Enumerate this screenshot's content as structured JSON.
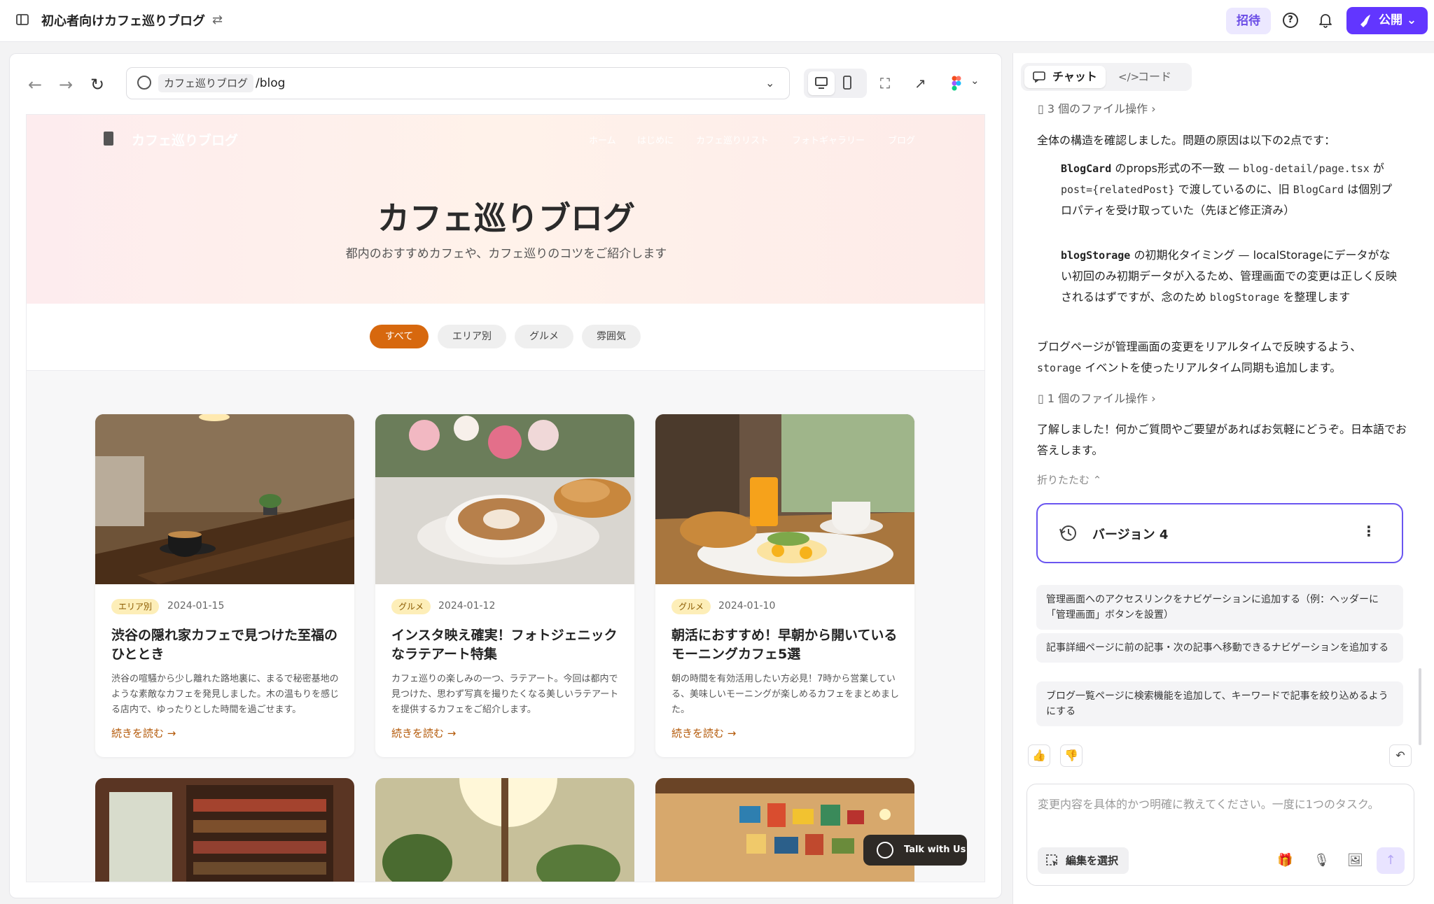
{
  "app": {
    "project_title": "初心者向けカフェ巡りブログ",
    "invite_label": "招待",
    "publish_label": "公開"
  },
  "browser": {
    "site_label": "カフェ巡りブログ",
    "path": "/blog"
  },
  "site": {
    "name": "カフェ巡りブログ",
    "menu": [
      "ホーム",
      "はじめに",
      "カフェ巡りリスト",
      "フォトギャラリー",
      "ブログ"
    ],
    "hero_title": "カフェ巡りブログ",
    "hero_subtitle": "都内のおすすめカフェや、カフェ巡りのコツをご紹介します",
    "filters": [
      "すべて",
      "エリア別",
      "グルメ",
      "雰囲気"
    ],
    "active_filter": "すべて",
    "posts": [
      {
        "tag": "エリア別",
        "date": "2024-01-15",
        "title": "渋谷の隠れ家カフェで見つけた至福のひととき",
        "excerpt": "渋谷の喧騒から少し離れた路地裏に、まるで秘密基地のような素敵なカフェを発見しました。木の温もりを感じる店内で、ゆったりとした時間を過ごせます。",
        "read_more": "続きを読む"
      },
      {
        "tag": "グルメ",
        "date": "2024-01-12",
        "title": "インスタ映え確実！フォトジェニックなラテアート特集",
        "excerpt": "カフェ巡りの楽しみの一つ、ラテアート。今回は都内で見つけた、思わず写真を撮りたくなる美しいラテアートを提供するカフェをご紹介します。",
        "read_more": "続きを読む"
      },
      {
        "tag": "グルメ",
        "date": "2024-01-10",
        "title": "朝活におすすめ！早朝から開いているモーニングカフェ5選",
        "excerpt": "朝の時間を有効活用したい方必見！7時から営業している、美味しいモーニングが楽しめるカフェをまとめました。",
        "read_more": "続きを読む"
      }
    ],
    "talk_label": "Talk with Us"
  },
  "chat": {
    "tab_chat": "チャット",
    "tab_code": "コード",
    "fileop_1": "3 個のファイル操作",
    "intro": "全体の構造を確認しました。問題の原因は以下の2点です：",
    "item1": {
      "code_a": "BlogCard",
      "text_a": "のprops形式の不一致 —",
      "code_b": "blog-detail/page.tsx",
      "text_b": "が",
      "code_c": "post={relatedPost}",
      "text_c": "で渡しているのに、旧",
      "code_d": "BlogCard",
      "text_d": "は個別プロパティを受け取っていた（先ほど修正済み）"
    },
    "item2": {
      "code_a": "blogStorage",
      "text_a": "の初期化タイミング — localStorageにデータがない初回のみ初期データが入るため、管理画面での変更は正しく反映されるはずですが、念のため",
      "code_b": "blogStorage",
      "text_b": "を整理します"
    },
    "para2_a": "ブログページが管理画面の変更をリアルタイムで反映するよう、",
    "para2_code": "storage",
    "para2_b": "イベントを使ったリアルタイム同期も追加します。",
    "fileop_2": "1 個のファイル操作",
    "para3": "了解しました！何かご質問やご要望があればお気軽にどうぞ。日本語でお答えします。",
    "collapse": "折りたたむ",
    "version_label": "バージョン 4",
    "suggestions": [
      "管理画面へのアクセスリンクをナビゲーションに追加する（例：ヘッダーに「管理画面」ボタンを設置）",
      "記事詳細ページに前の記事・次の記事へ移動できるナビゲーションを追加する",
      "ブログ一覧ページに検索機能を追加して、キーワードで記事を絞り込めるようにする"
    ],
    "input_placeholder": "変更内容を具体的かつ明確に教えてください。一度に1つのタスク。",
    "edit_select": "編集を選択"
  },
  "colors": {
    "accent": "#6236ff",
    "site_accent": "#d7680e",
    "tag_bg": "#fdeeb8"
  }
}
